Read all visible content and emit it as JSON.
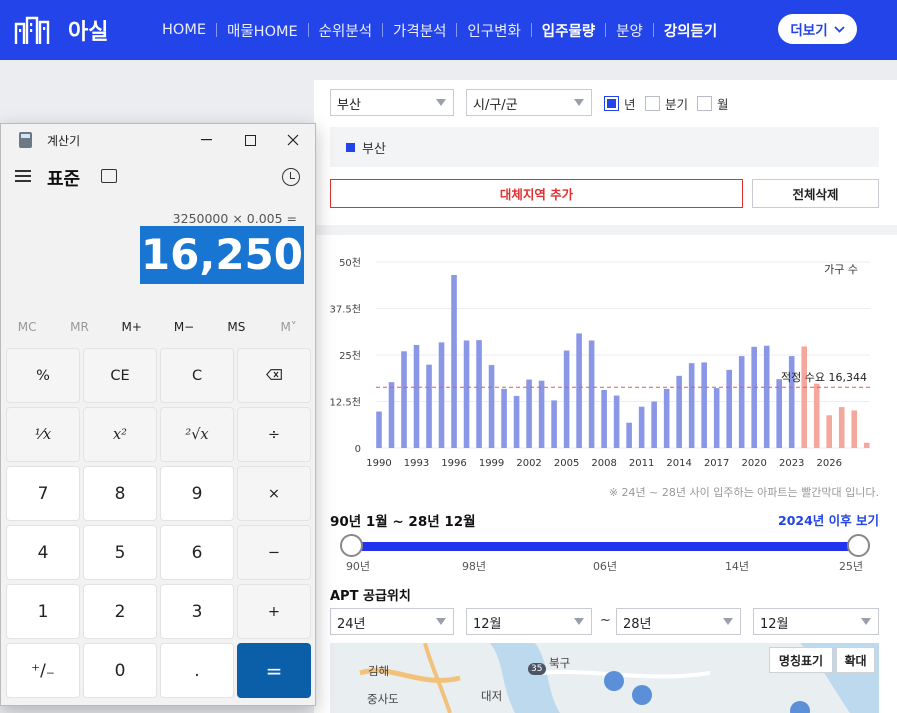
{
  "nav": {
    "logo_text": "아실",
    "items": [
      {
        "label": "HOME",
        "bold": false
      },
      {
        "label": "매물HOME",
        "bold": false
      },
      {
        "label": "순위분석",
        "bold": false
      },
      {
        "label": "가격분석",
        "bold": false
      },
      {
        "label": "인구변화",
        "bold": false
      },
      {
        "label": "입주물량",
        "bold": true
      },
      {
        "label": "분양",
        "bold": false
      },
      {
        "label": "강의듣기",
        "bold": true
      }
    ],
    "more_label": "더보기"
  },
  "filters": {
    "region_select": "부산",
    "district_select": "시/구/군",
    "period_options": [
      {
        "label": "년",
        "checked": true
      },
      {
        "label": "분기",
        "checked": false
      },
      {
        "label": "월",
        "checked": false
      }
    ]
  },
  "selected_region": "부산",
  "buttons": {
    "add_region": "대체지역 추가",
    "clear_all": "전체삭제"
  },
  "chart_data": {
    "type": "bar",
    "legend": "가구 수",
    "y_ticks": [
      "50천",
      "37.5천",
      "25천",
      "12.5천",
      "0"
    ],
    "ylim": [
      0,
      50000
    ],
    "x_tick_labels": [
      "1990",
      "1993",
      "1996",
      "1999",
      "2002",
      "2005",
      "2008",
      "2011",
      "2014",
      "2017",
      "2020",
      "2023",
      "2026"
    ],
    "years": [
      1990,
      1991,
      1992,
      1993,
      1994,
      1995,
      1996,
      1997,
      1998,
      1999,
      2000,
      2001,
      2002,
      2003,
      2004,
      2005,
      2006,
      2007,
      2008,
      2009,
      2010,
      2011,
      2012,
      2013,
      2014,
      2015,
      2016,
      2017,
      2018,
      2019,
      2020,
      2021,
      2022,
      2023,
      2024,
      2025,
      2026,
      2027,
      2028
    ],
    "values": [
      9800,
      17700,
      26000,
      27700,
      22400,
      28400,
      46500,
      28900,
      29000,
      22300,
      15900,
      14000,
      18400,
      18100,
      12800,
      26200,
      30800,
      28900,
      15600,
      14100,
      6800,
      11100,
      12500,
      15900,
      19400,
      22800,
      23000,
      16100,
      21000,
      24700,
      27200,
      27500,
      18500,
      24700,
      27300,
      17300,
      8800,
      11000,
      10100,
      1400
    ],
    "future_from_year": 2024,
    "reference_line": {
      "label": "적정 수요 16,344",
      "value": 16344
    }
  },
  "chart_note": "※ 24년 ~ 28년 사이 입주하는 아파트는 빨간막대 입니다.",
  "range": {
    "label": "90년 1월 ~ 28년 12월",
    "after_link": "2024년 이후 보기",
    "ticks": [
      "90년",
      "98년",
      "06년",
      "14년",
      "25년"
    ]
  },
  "apt": {
    "label": "APT 공급위치",
    "from_year": "24년",
    "from_month": "12월",
    "tilde": "~",
    "to_year": "28년",
    "to_month": "12월"
  },
  "map": {
    "labels": [
      "김해",
      "북구",
      "중사도",
      "대저"
    ],
    "road_number": "35",
    "btn_names": "명칭표기",
    "btn_zoom": "확대"
  },
  "calculator": {
    "title": "계산기",
    "mode": "표준",
    "expression": "3250000 × 0.005 =",
    "result": "16,250",
    "memory": [
      {
        "label": "MC",
        "enabled": false
      },
      {
        "label": "MR",
        "enabled": false
      },
      {
        "label": "M+",
        "enabled": true
      },
      {
        "label": "M−",
        "enabled": true
      },
      {
        "label": "MS",
        "enabled": true
      },
      {
        "label": "M˅",
        "enabled": false
      }
    ],
    "keys": [
      [
        "%",
        "CE",
        "C",
        "⌫"
      ],
      [
        "¹⁄x",
        "x²",
        "²√x",
        "÷"
      ],
      [
        "7",
        "8",
        "9",
        "×"
      ],
      [
        "4",
        "5",
        "6",
        "−"
      ],
      [
        "1",
        "2",
        "3",
        "+"
      ],
      [
        "⁺/₋",
        "0",
        ".",
        "="
      ]
    ]
  }
}
